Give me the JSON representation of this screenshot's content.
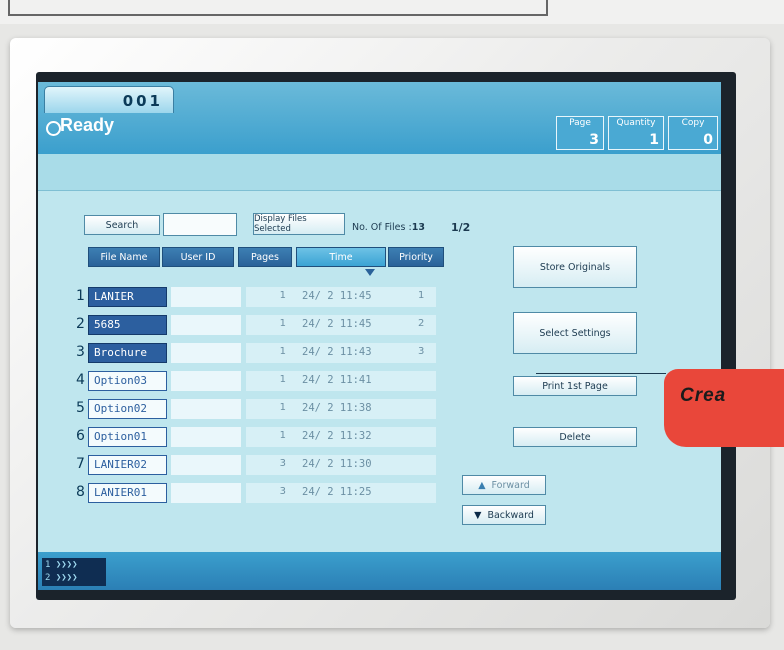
{
  "job": {
    "number": "001",
    "status": "Ready"
  },
  "counters": [
    {
      "label": "Page",
      "value": "3"
    },
    {
      "label": "Quantity",
      "value": "1"
    },
    {
      "label": "Copy",
      "value": "0"
    }
  ],
  "toolbar": {
    "search_label": "Search",
    "display_label": "Display Files Selected",
    "files_label": "No. Of Files :",
    "files_count": "13",
    "page_indicator": "1/2"
  },
  "columns": {
    "file_name": "File Name",
    "user_id": "User ID",
    "pages": "Pages",
    "time": "Time",
    "priority": "Priority"
  },
  "rows": [
    {
      "num": "1",
      "name": "LANIER",
      "pages": "1",
      "time": "24/ 2 11:45",
      "priority": "1"
    },
    {
      "num": "2",
      "name": "5685",
      "pages": "1",
      "time": "24/ 2 11:45",
      "priority": "2"
    },
    {
      "num": "3",
      "name": "Brochure",
      "pages": "1",
      "time": "24/ 2 11:43",
      "priority": "3"
    },
    {
      "num": "4",
      "name": "Option03",
      "pages": "1",
      "time": "24/ 2 11:41",
      "priority": ""
    },
    {
      "num": "5",
      "name": "Option02",
      "pages": "1",
      "time": "24/ 2 11:38",
      "priority": ""
    },
    {
      "num": "6",
      "name": "Option01",
      "pages": "1",
      "time": "24/ 2 11:32",
      "priority": ""
    },
    {
      "num": "7",
      "name": "LANIER02",
      "pages": "3",
      "time": "24/ 2 11:30",
      "priority": ""
    },
    {
      "num": "8",
      "name": "LANIER01",
      "pages": "3",
      "time": "24/ 2 11:25",
      "priority": ""
    }
  ],
  "actions": {
    "store": "Store Originals",
    "select": "Select Settings",
    "print": "Print 1st Page",
    "delete": "Delete",
    "forward": "Forward",
    "backward": "Backward"
  },
  "bottom_icon": {
    "line1": "1 ❯❯❯❯",
    "line2": "2 ❯❯❯❯"
  },
  "overlay_text": "Crea",
  "colors": {
    "status_bar": "#3b9fcd",
    "selected_file": "#2c5f9f",
    "badge": "#e9473a"
  }
}
